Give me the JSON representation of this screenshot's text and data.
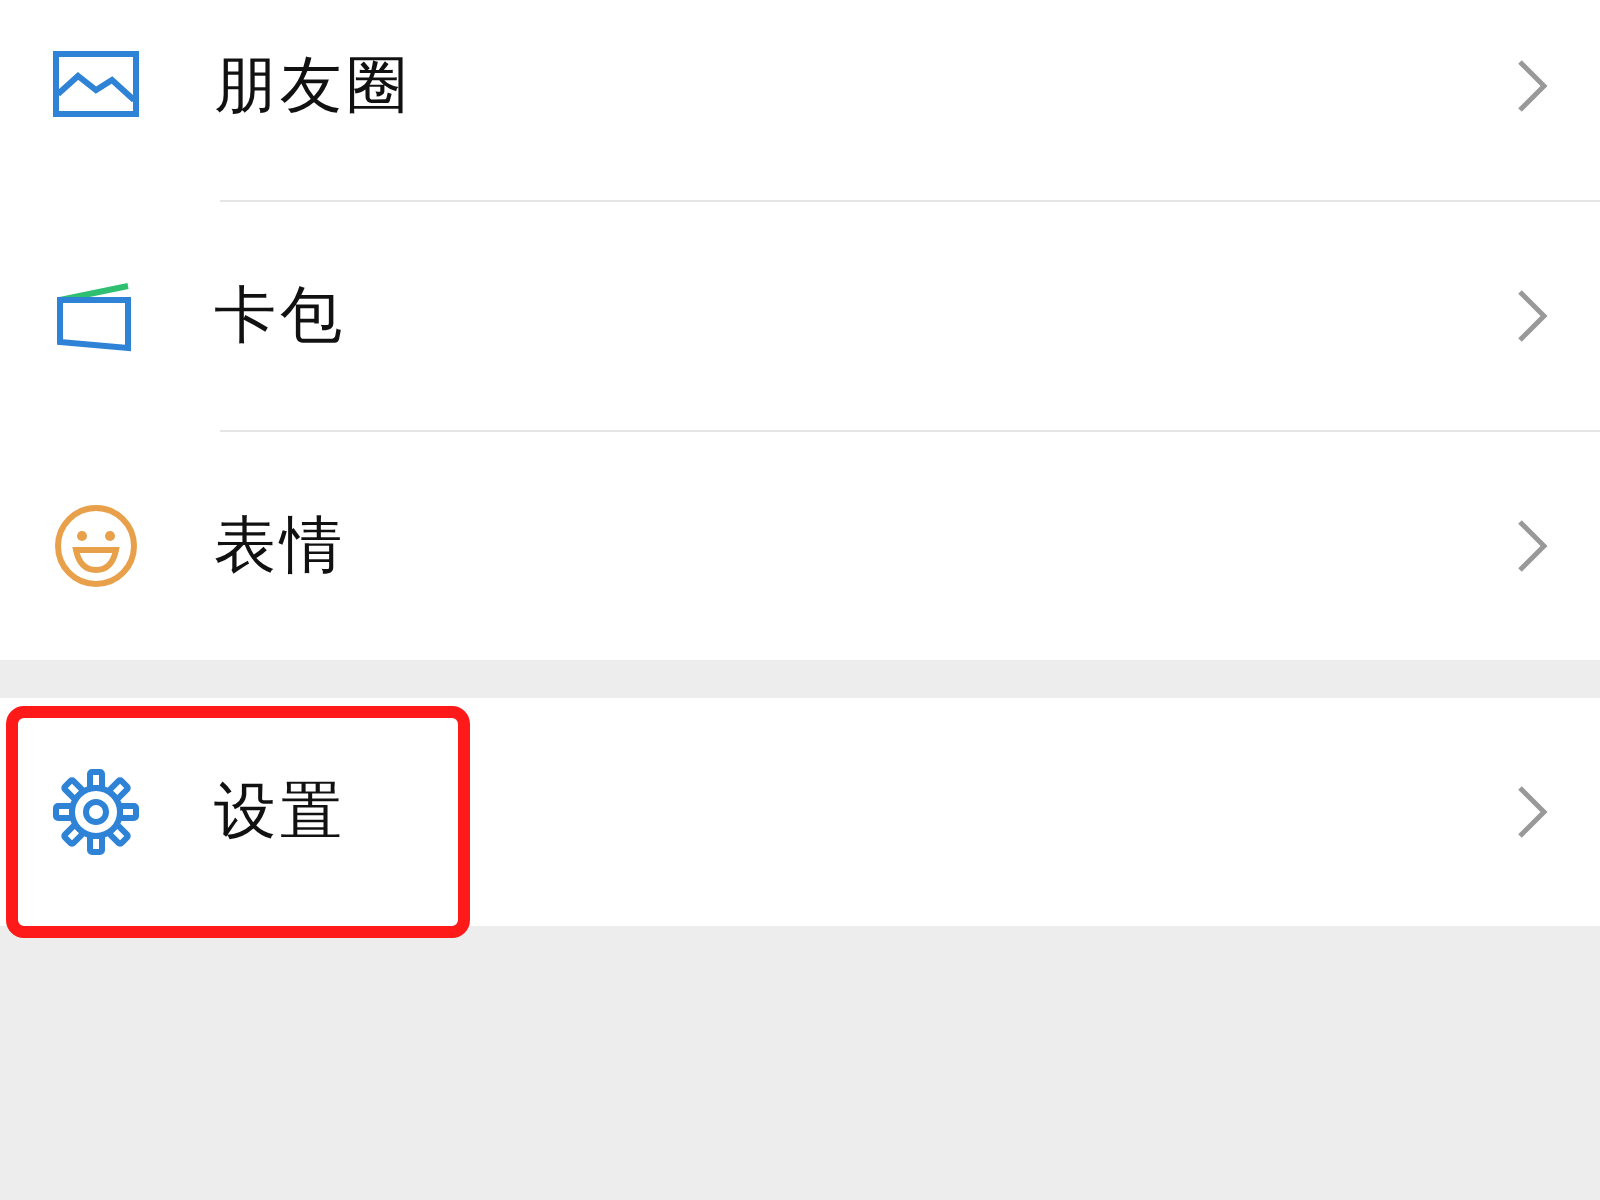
{
  "groups": [
    {
      "items": [
        {
          "label": "朋友圈",
          "kind": "moments",
          "highlighted": false
        },
        {
          "label": "卡包",
          "kind": "cards",
          "highlighted": false
        },
        {
          "label": "表情",
          "kind": "stickers",
          "highlighted": false
        }
      ]
    },
    {
      "items": [
        {
          "label": "设置",
          "kind": "settings",
          "highlighted": true
        }
      ]
    }
  ]
}
